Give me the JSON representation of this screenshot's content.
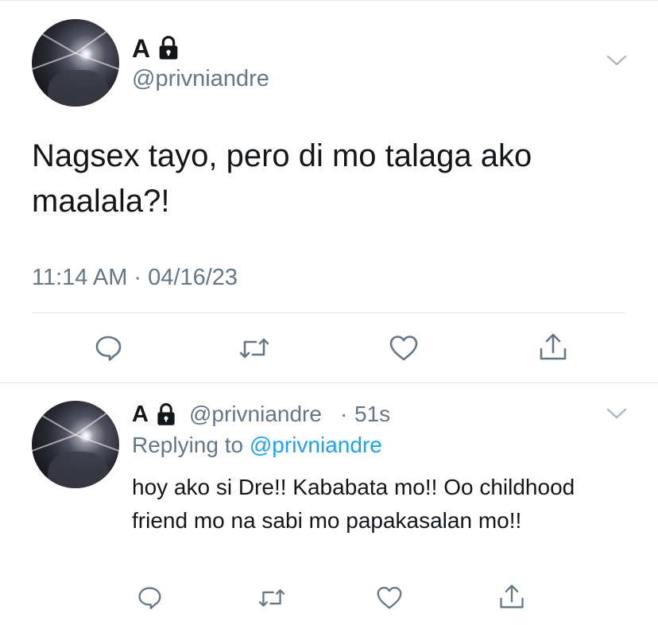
{
  "main_tweet": {
    "display_name": "A",
    "handle": "@privniandre",
    "text": "Nagsex tayo, pero di mo talaga ako maalala?!",
    "timestamp": "11:14 AM · 04/16/23",
    "protected_icon": "lock-icon",
    "menu_icon": "chevron-down-icon",
    "actions": [
      "comment-icon",
      "retweet-icon",
      "like-icon",
      "share-icon"
    ]
  },
  "reply_tweet": {
    "display_name": "A",
    "handle": "@privniandre",
    "separator": "·",
    "time_ago": "51s",
    "replying_prefix": "Replying to",
    "replying_to": "@privniandre",
    "text": "hoy ako si Dre!! Kababata mo!! Oo childhood friend mo na sabi mo papakasalan mo!!",
    "protected_icon": "lock-icon",
    "menu_icon": "chevron-down-icon",
    "actions": [
      "comment-icon",
      "retweet-icon",
      "like-icon",
      "share-icon"
    ]
  },
  "colors": {
    "text": "#14171a",
    "secondary": "#657786",
    "link": "#1da1f2",
    "divider": "#e1e8ed"
  }
}
